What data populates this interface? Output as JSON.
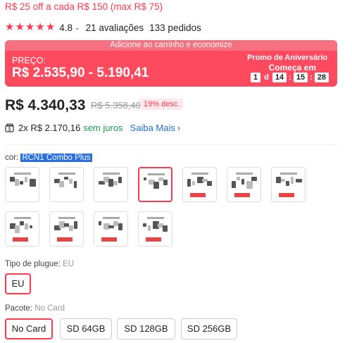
{
  "coupon_text": "R$ 25 off a cada R$ 150 (max R$ 75)",
  "rating": {
    "stars": 5,
    "score": "4.8",
    "reviews": "21 avaliações",
    "orders": "133 pedidos"
  },
  "banner": {
    "top_text": "Adicione ao carrinho e economize",
    "price_label": "PREÇO:",
    "price_range": "R$ 2.535,90 - 5.190,41",
    "promo_title": "Promo de Aniversário",
    "promo_sub": "Começa em",
    "countdown": {
      "days": "1",
      "day_unit": "d",
      "hours": "14",
      "minutes": "15",
      "seconds": "28"
    }
  },
  "price": {
    "current": "R$ 4.340,33",
    "original": "R$ 5.358,40",
    "discount": "19% desc."
  },
  "installment": {
    "text": "2x R$ 2.170,16",
    "interest": "sem juros",
    "more": "Saiba Mais"
  },
  "color": {
    "label": "cor:",
    "selected": "RCN1 Combo Plus",
    "swatches": [
      {
        "name": "Option 1"
      },
      {
        "name": "Option 2"
      },
      {
        "name": "Option 3"
      },
      {
        "name": "RCN1 Combo Plus",
        "selected": true
      },
      {
        "name": "Option 5"
      },
      {
        "name": "Option 6"
      },
      {
        "name": "Option 7"
      },
      {
        "name": "Option 8"
      },
      {
        "name": "Option 9"
      },
      {
        "name": "Option 10"
      },
      {
        "name": "Option 11"
      }
    ]
  },
  "plug": {
    "label": "Tipo de plugue:",
    "selected": "EU",
    "options": [
      "EU"
    ]
  },
  "pacote": {
    "label": "Pacote:",
    "selected": "No Card",
    "options": [
      "No Card",
      "SD 64GB",
      "SD 128GB",
      "SD 256GB"
    ]
  },
  "colors": {
    "accent": "#fd384f",
    "banner": "#fd4a5e",
    "green": "#1a9b52",
    "link": "#1f6bdb"
  }
}
